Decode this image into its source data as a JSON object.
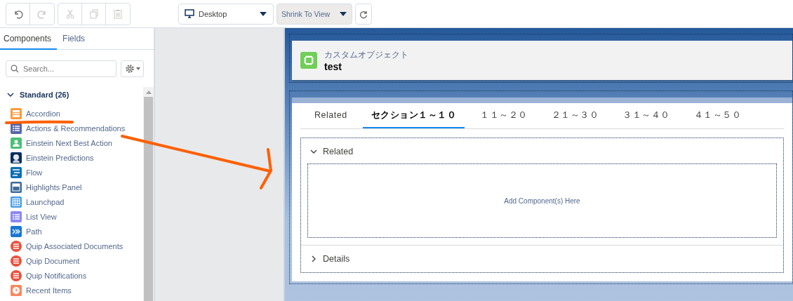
{
  "toolbar": {
    "buttons": [
      {
        "kind": "undo",
        "disabled": false
      },
      {
        "kind": "redo",
        "disabled": true
      },
      {
        "kind": "cut",
        "disabled": true
      },
      {
        "kind": "copy",
        "disabled": true
      },
      {
        "kind": "paste",
        "disabled": true
      }
    ],
    "device": "Desktop",
    "zoom": "Shrink To View"
  },
  "sidebar": {
    "tabs": [
      {
        "label": "Components",
        "selected": true
      },
      {
        "label": "Fields",
        "selected": false
      }
    ],
    "search": {
      "placeholder": "Search..."
    },
    "group": {
      "label": "Standard (26)",
      "expanded": true,
      "items": [
        {
          "label": "Accordion",
          "kind": "rows",
          "color": "#ff9a3c"
        },
        {
          "label": "Actions & Recommendations",
          "kind": "list",
          "color": "#5867a8"
        },
        {
          "label": "Einstein Next Best Action",
          "kind": "person",
          "color": "#4bc076"
        },
        {
          "label": "Einstein Predictions",
          "kind": "figure",
          "color": "#032d60"
        },
        {
          "label": "Flow",
          "kind": "flow",
          "color": "#0b6fb5"
        },
        {
          "label": "Highlights Panel",
          "kind": "panel",
          "color": "#3e6b98"
        },
        {
          "label": "Launchpad",
          "kind": "grid",
          "color": "#4d9ee6"
        },
        {
          "label": "List View",
          "kind": "list",
          "color": "#8c89f2"
        },
        {
          "label": "Path",
          "kind": "path",
          "color": "#1b76d1"
        },
        {
          "label": "Quip Associated Documents",
          "kind": "doc",
          "color": "#e8533f"
        },
        {
          "label": "Quip Document",
          "kind": "doc",
          "color": "#e8533f"
        },
        {
          "label": "Quip Notifications",
          "kind": "doc",
          "color": "#e8533f"
        },
        {
          "label": "Recent Items",
          "kind": "clock",
          "color": "#f88962"
        }
      ]
    }
  },
  "record": {
    "object": "カスタムオブジェクト",
    "name": "test"
  },
  "tabs": [
    {
      "label": "Related",
      "selected": false
    },
    {
      "label": "セクション１～１０",
      "selected": true
    },
    {
      "label": "１１～２０",
      "selected": false
    },
    {
      "label": "２１～３０",
      "selected": false
    },
    {
      "label": "３１～４０",
      "selected": false
    },
    {
      "label": "４１～５０",
      "selected": false
    }
  ],
  "sections": [
    {
      "label": "Related",
      "expanded": true,
      "placeholder": "Add Component(s) Here"
    },
    {
      "label": "Details",
      "expanded": false
    }
  ]
}
